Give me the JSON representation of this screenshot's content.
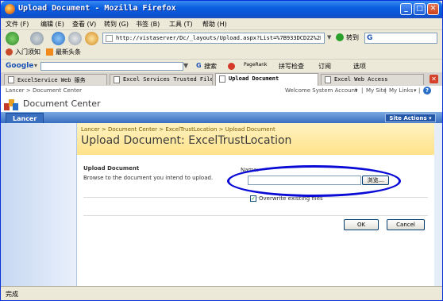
{
  "window": {
    "title": "Upload Document - Mozilla Firefox"
  },
  "menu": [
    "文件 (F)",
    "编辑 (E)",
    "查看 (V)",
    "转到 (G)",
    "书签 (B)",
    "工具 (T)",
    "帮助 (H)"
  ],
  "nav": {
    "url": "http://vistaserver/Dc/_layouts/Upload.aspx?List=%7B933DCD22%2D0A45%2",
    "go_label": "转到",
    "search_label": "G"
  },
  "bookmarks": [
    "入门须知",
    "最新头条"
  ],
  "google_toolbar": {
    "brand": "Google",
    "search_label": "搜索",
    "pagerank": "PageRank",
    "spell": "拼写检查",
    "subscribe": "订阅",
    "options": "选项"
  },
  "tabs": [
    {
      "label": "ExcelService Web 服务",
      "active": false
    },
    {
      "label": "Excel Services Trusted File...",
      "active": false
    },
    {
      "label": "Upload Document",
      "active": true
    },
    {
      "label": "Excel Web Access",
      "active": false
    }
  ],
  "sharepoint": {
    "top_breadcrumb": "Lancer > Document Center",
    "welcome": "Welcome System Account",
    "my_site": "My Site",
    "my_links": "My Links",
    "site_title": "Document Center",
    "nav_tab": "Lancer",
    "site_actions": "Site Actions",
    "breadcrumb": "Lancer > Document Center > ExcelTrustLocation > Upload Document",
    "page_title": "Upload Document: ExcelTrustLocation",
    "section_title": "Upload Document",
    "section_desc": "Browse to the document you intend to upload.",
    "name_label": "Name:",
    "browse_label": "浏览...",
    "overwrite_label": "Overwrite existing files",
    "overwrite_checked": true,
    "ok_label": "OK",
    "cancel_label": "Cancel"
  },
  "status": "完成"
}
